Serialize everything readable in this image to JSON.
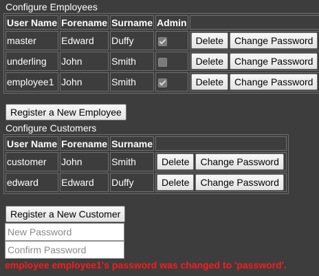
{
  "employees_section": {
    "title": "Configure Employees",
    "headers": [
      "User Name",
      "Forename",
      "Surname",
      "Admin"
    ],
    "rows": [
      {
        "username": "master",
        "forename": "Edward",
        "surname": "Duffy",
        "admin": true
      },
      {
        "username": "underling",
        "forename": "John",
        "surname": "Smith",
        "admin": false
      },
      {
        "username": "employee1",
        "forename": "John",
        "surname": "Smith",
        "admin": true
      }
    ],
    "delete_label": "Delete",
    "change_password_label": "Change Password",
    "register_label": "Register a New Employee"
  },
  "customers_section": {
    "title": "Configure Customers",
    "headers": [
      "User Name",
      "Forename",
      "Surname"
    ],
    "rows": [
      {
        "username": "customer",
        "forename": "John",
        "surname": "Smith"
      },
      {
        "username": "edward",
        "forename": "Edward",
        "surname": "Duffy"
      }
    ],
    "delete_label": "Delete",
    "change_password_label": "Change Password",
    "register_label": "Register a New Customer"
  },
  "password_form": {
    "new_password_placeholder": "New Password",
    "new_password_value": "",
    "confirm_password_placeholder": "Confirm Password",
    "confirm_password_value": ""
  },
  "status_message": "employee employee1's password was changed to 'password'.",
  "colors": {
    "background": "#3d3d3d",
    "text": "#ffffff",
    "status": "#ff1a1a"
  }
}
